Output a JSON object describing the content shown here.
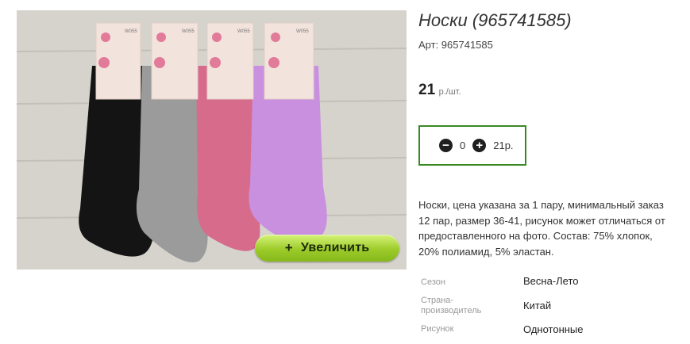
{
  "product": {
    "title": "Носки (965741585)",
    "article": "Арт: 965741585",
    "price_value": "21",
    "price_unit": "р./шт."
  },
  "zoom": {
    "plus": "+",
    "label": "Увеличить"
  },
  "quantity": {
    "minus_symbol": "−",
    "plus_symbol": "+",
    "value": "0",
    "total": "21р."
  },
  "description": [
    "Носки, цена указана за 1 пару, минимальный заказ",
    "12 пар, размер 36-41, рисунок может отличаться от",
    "предоставленного на фото. Состав: 75% хлопок,",
    "20% полиамид, 5% эластан."
  ],
  "properties": [
    {
      "label_lines": [
        "Сезон"
      ],
      "value": "Весна-Лето"
    },
    {
      "label_lines": [
        "Страна-",
        "производитель"
      ],
      "value": "Китай"
    },
    {
      "label_lines": [
        "Рисунок"
      ],
      "value": "Однотонные"
    }
  ],
  "photo": {
    "tag_codes": [
      "W055",
      "W055",
      "W055",
      "W055"
    ],
    "sock_colors": [
      "#141414",
      "#9b9b9b",
      "#d76b8c",
      "#c990e0"
    ],
    "background_color": "#d9d6d0"
  }
}
